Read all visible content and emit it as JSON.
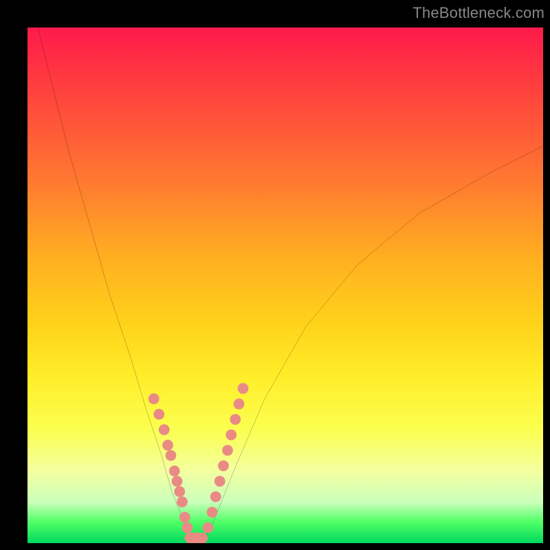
{
  "watermark": "TheBottleneck.com",
  "chart_data": {
    "type": "line",
    "title": "",
    "xlabel": "",
    "ylabel": "",
    "xlim": [
      0,
      100
    ],
    "ylim": [
      0,
      100
    ],
    "grid": false,
    "legend": "none",
    "background": "vertical_gradient",
    "gradient_colors": [
      "#ff1a4b",
      "#ff7a30",
      "#ffd41a",
      "#fbff50",
      "#4eff65",
      "#00d95f"
    ],
    "series": [
      {
        "name": "left-curve",
        "type": "line",
        "color": "#000000",
        "x": [
          2,
          5,
          8,
          12,
          16,
          20,
          23,
          26,
          28,
          30,
          31,
          32
        ],
        "y": [
          100,
          88,
          76,
          62,
          48,
          36,
          26,
          17,
          10,
          5,
          2,
          0
        ]
      },
      {
        "name": "right-curve",
        "type": "line",
        "color": "#000000",
        "x": [
          34,
          36,
          40,
          46,
          54,
          64,
          76,
          90,
          100
        ],
        "y": [
          0,
          4,
          14,
          28,
          42,
          54,
          64,
          72,
          77
        ]
      },
      {
        "name": "left-dots",
        "type": "scatter",
        "color": "#e98b84",
        "x": [
          24.5,
          25.5,
          26.5,
          27.2,
          27.8,
          28.5,
          29.0,
          29.5,
          30.0,
          30.5,
          31.0
        ],
        "y": [
          28,
          25,
          22,
          19,
          17,
          14,
          12,
          10,
          8,
          5,
          3
        ]
      },
      {
        "name": "right-dots",
        "type": "scatter",
        "color": "#e98b84",
        "x": [
          35.0,
          35.8,
          36.5,
          37.3,
          38.0,
          38.8,
          39.5,
          40.3,
          41.0,
          41.8
        ],
        "y": [
          3,
          6,
          9,
          12,
          15,
          18,
          21,
          24,
          27,
          30
        ]
      },
      {
        "name": "bottom-dots",
        "type": "scatter",
        "color": "#e98b84",
        "x": [
          31.5,
          32.3,
          33.1,
          33.9
        ],
        "y": [
          1,
          1,
          1,
          1
        ]
      }
    ]
  }
}
